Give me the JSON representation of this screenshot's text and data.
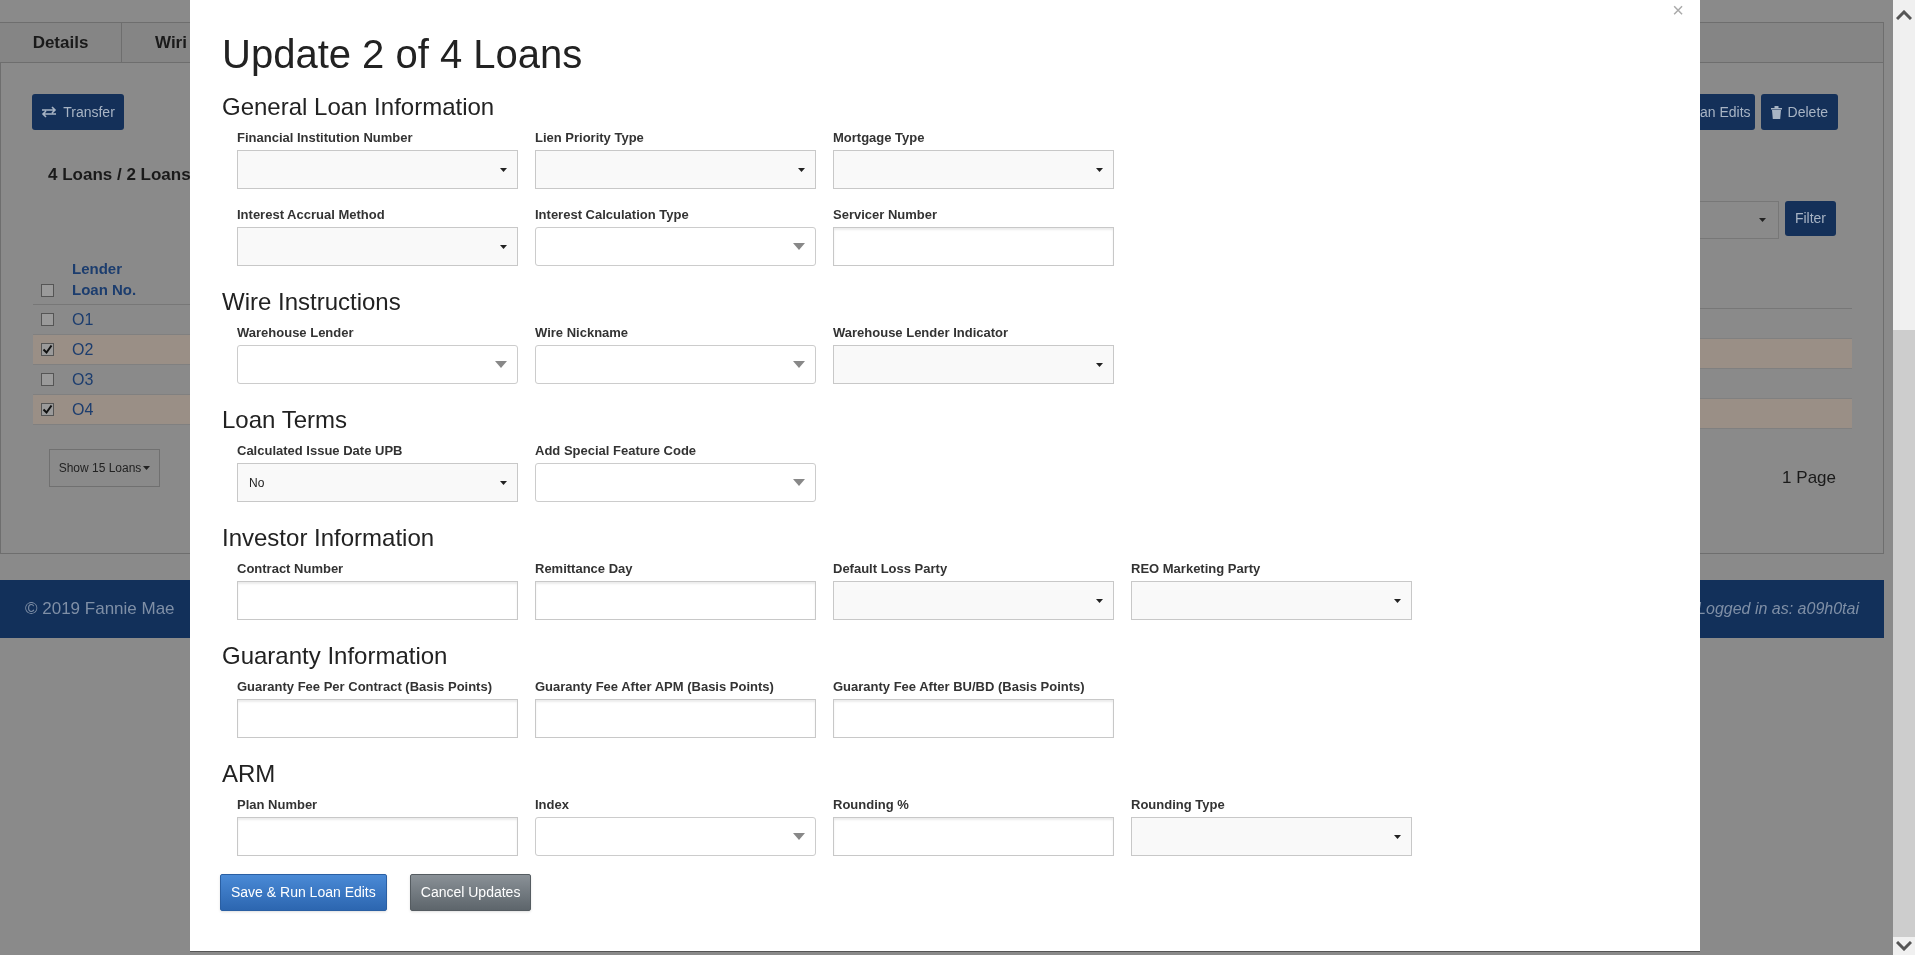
{
  "background": {
    "tabs": [
      {
        "label": "Details"
      },
      {
        "label": "Wiri"
      }
    ],
    "transfer_button": "Transfer",
    "loan_count": "4 Loans / 2 Loans",
    "table": {
      "header": "Lender Loan No.",
      "header_checked": false,
      "rows": [
        {
          "loan_no": "O1",
          "selected": false
        },
        {
          "loan_no": "O2",
          "selected": true
        },
        {
          "loan_no": "O3",
          "selected": false
        },
        {
          "loan_no": "O4",
          "selected": true
        }
      ]
    },
    "show_button": "Show 15 Loans",
    "edits_button": "an Edits",
    "delete_button": "Delete",
    "filter_button": "Filter",
    "pages": "1 Page",
    "footer": {
      "copyright": "© 2019 Fannie Mae",
      "user": "Logged in as: a09h0tai"
    }
  },
  "modal": {
    "title": "Update 2 of 4 Loans",
    "close": "×",
    "sections": [
      {
        "heading": "General Loan Information",
        "fields": [
          {
            "label": "Financial Institution Number",
            "kind": "select"
          },
          {
            "label": "Lien Priority Type",
            "kind": "select"
          },
          {
            "label": "Mortgage Type",
            "kind": "select"
          },
          {
            "label": "Interest Accrual Method",
            "kind": "select"
          },
          {
            "label": "Interest Calculation Type",
            "kind": "combo"
          },
          {
            "label": "Servicer Number",
            "kind": "text"
          }
        ]
      },
      {
        "heading": "Wire Instructions",
        "fields": [
          {
            "label": "Warehouse Lender",
            "kind": "combo"
          },
          {
            "label": "Wire Nickname",
            "kind": "combo"
          },
          {
            "label": "Warehouse Lender Indicator",
            "kind": "select"
          }
        ]
      },
      {
        "heading": "Loan Terms",
        "fields": [
          {
            "label": "Calculated Issue Date UPB",
            "kind": "select",
            "value": "No"
          },
          {
            "label": "Add Special Feature Code",
            "kind": "combo"
          }
        ]
      },
      {
        "heading": "Investor Information",
        "fields": [
          {
            "label": "Contract Number",
            "kind": "text"
          },
          {
            "label": "Remittance Day",
            "kind": "text"
          },
          {
            "label": "Default Loss Party",
            "kind": "select"
          },
          {
            "label": "REO Marketing Party",
            "kind": "select"
          }
        ]
      },
      {
        "heading": "Guaranty Information",
        "fields": [
          {
            "label": "Guaranty Fee Per Contract (Basis Points)",
            "kind": "text"
          },
          {
            "label": "Guaranty Fee After APM (Basis Points)",
            "kind": "text"
          },
          {
            "label": "Guaranty Fee After BU/BD (Basis Points)",
            "kind": "text"
          }
        ]
      },
      {
        "heading": "ARM",
        "fields": [
          {
            "label": "Plan Number",
            "kind": "text"
          },
          {
            "label": "Index",
            "kind": "combo"
          },
          {
            "label": "Rounding %",
            "kind": "text"
          },
          {
            "label": "Rounding Type",
            "kind": "select"
          }
        ]
      }
    ],
    "buttons": [
      {
        "label": "Save & Run Loan Edits",
        "kind": "primary"
      },
      {
        "label": "Cancel Updates",
        "kind": "secondary"
      }
    ]
  }
}
